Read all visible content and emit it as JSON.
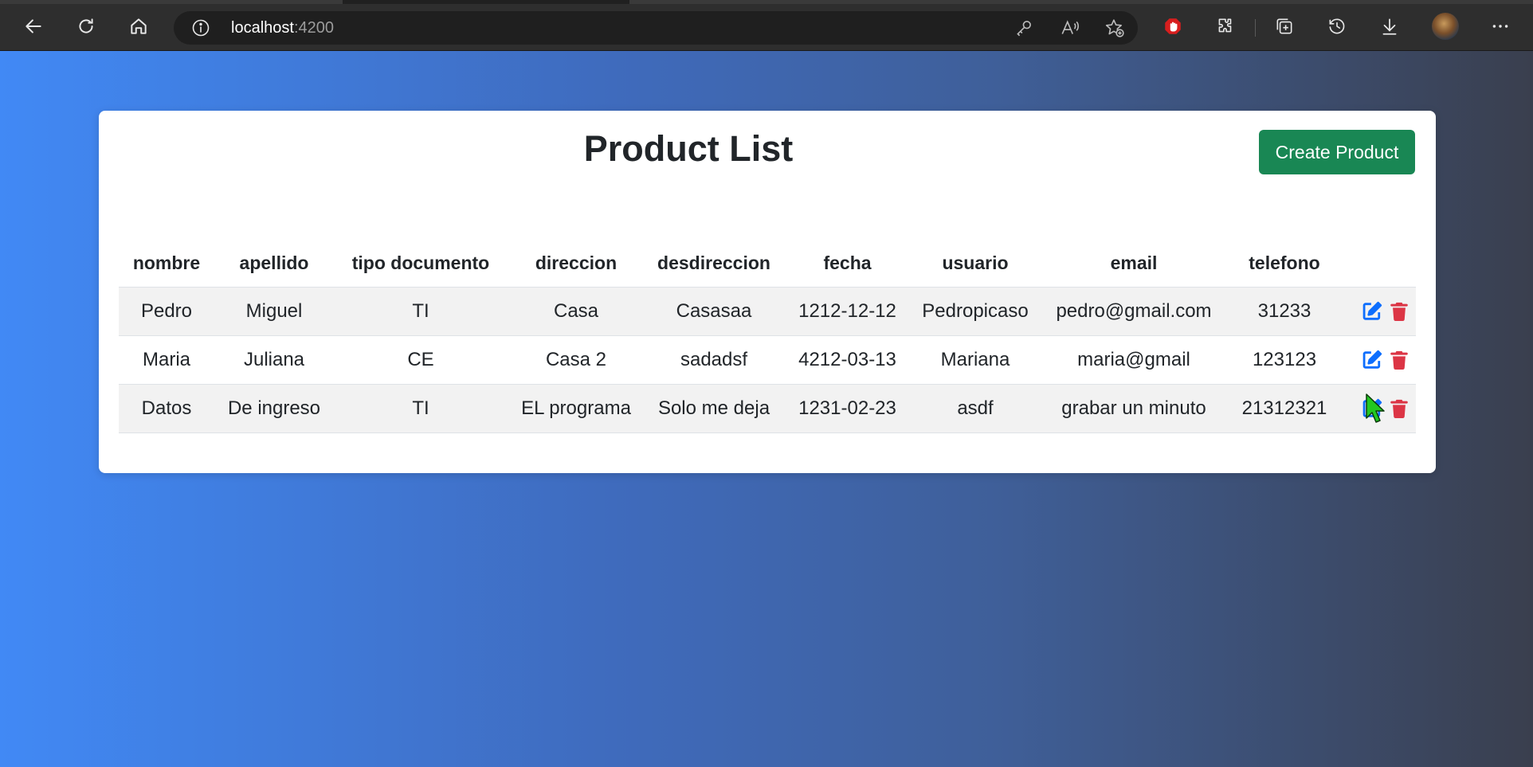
{
  "browser": {
    "url_host": "localhost",
    "url_port": ":4200"
  },
  "page": {
    "title": "Product List",
    "create_button": "Create Product"
  },
  "table": {
    "headers": [
      "nombre",
      "apellido",
      "tipo documento",
      "direccion",
      "desdireccion",
      "fecha",
      "usuario",
      "email",
      "telefono",
      ""
    ],
    "rows": [
      [
        "Pedro",
        "Miguel",
        "TI",
        "Casa",
        "Casasaa",
        "1212-12-12",
        "Pedropicaso",
        "pedro@gmail.com",
        "31233"
      ],
      [
        "Maria",
        "Juliana",
        "CE",
        "Casa 2",
        "sadadsf",
        "4212-03-13",
        "Mariana",
        "maria@gmail",
        "123123"
      ],
      [
        "Datos",
        "De ingreso",
        "TI",
        "EL programa",
        "Solo me deja",
        "1231-02-23",
        "asdf",
        "grabar un minuto",
        "21312321"
      ]
    ]
  },
  "colors": {
    "create_button": "#198754",
    "edit_icon": "#0d6efd",
    "delete_icon": "#dc3545",
    "cursor": "#22c822"
  },
  "icons": {
    "edit": "pen-to-square-icon",
    "delete": "trash-icon"
  }
}
